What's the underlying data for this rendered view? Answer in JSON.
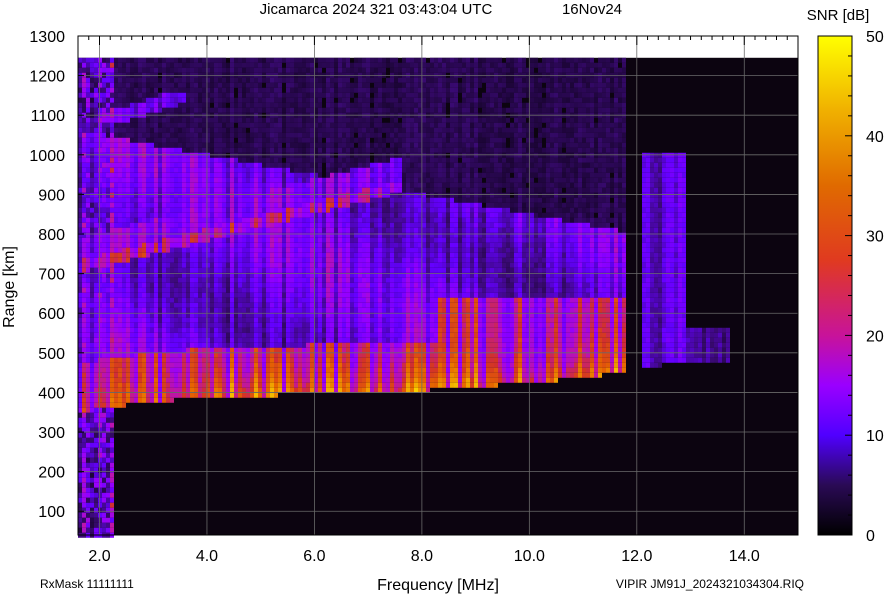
{
  "header": {
    "title": "Jicamarca 2024 321 03:43:04 UTC",
    "date": "16Nov24"
  },
  "footer": {
    "rxmask": "RxMask 11111111",
    "file": "VIPIR  JM91J_2024321034304.RIQ"
  },
  "chart_data": {
    "type": "heatmap",
    "title": "Jicamarca 2024 321 03:43:04 UTC",
    "xlabel": "Frequency [MHz]",
    "ylabel": "Range [km]",
    "xlim": [
      1.6,
      15.0
    ],
    "ylim": [
      40,
      1300
    ],
    "x_ticks": [
      2,
      4,
      6,
      8,
      10,
      12,
      14
    ],
    "x_tick_labels": [
      "2.0",
      "4.0",
      "6.0",
      "8.0",
      "10.0",
      "12.0",
      "14.0"
    ],
    "y_ticks": [
      100,
      200,
      300,
      400,
      500,
      600,
      700,
      800,
      900,
      1000,
      1100,
      1200,
      1300
    ],
    "y_tick_labels": [
      "100",
      "200",
      "300",
      "400",
      "500",
      "600",
      "700",
      "800",
      "900",
      "1000",
      "1100",
      "1200",
      "1300"
    ],
    "grid": true,
    "colorbar": {
      "label": "SNR [dB]",
      "min": 0,
      "max": 50,
      "ticks": [
        0,
        10,
        20,
        30,
        40,
        50
      ],
      "tick_labels": [
        "0",
        "10",
        "20",
        "30",
        "40",
        "50"
      ],
      "colors": [
        "#000000",
        "#3a0a6a",
        "#6a00ff",
        "#b000ff",
        "#d02090",
        "#e05000",
        "#f0a000",
        "#ffff00"
      ]
    },
    "echo_traces": {
      "o_trace_lower_edge": {
        "freq_mhz": [
          1.6,
          2.0,
          3.0,
          4.0,
          5.0,
          6.0,
          7.0,
          8.0,
          9.0,
          10.0,
          11.0,
          12.0,
          13.0,
          14.0
        ],
        "range_km": [
          350,
          362,
          380,
          390,
          395,
          400,
          402,
          408,
          418,
          428,
          440,
          460,
          478,
          500
        ]
      },
      "multihop_trace": {
        "freq_mhz": [
          1.6,
          2.5,
          3.5,
          4.5,
          5.5,
          6.5,
          7.5
        ],
        "range_km": [
          710,
          740,
          780,
          805,
          820,
          830,
          840
        ]
      }
    }
  }
}
